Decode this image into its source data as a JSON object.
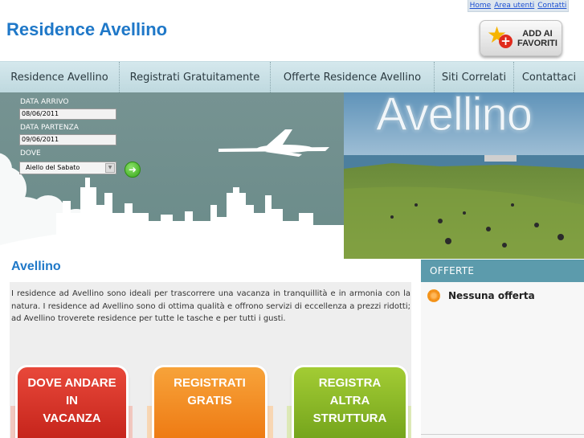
{
  "top_links": [
    "Home",
    "Area utenti",
    "Contatti"
  ],
  "site_title": "Residence Avellino",
  "favorites_button": {
    "line1": "ADD AI",
    "line2": "FAVORITI"
  },
  "nav": [
    "Residence Avellino",
    "Registrati Gratuitamente",
    "Offerte Residence Avellino",
    "Siti Correlati",
    "Contattaci"
  ],
  "search_form": {
    "arrival_label": "DATA ARRIVO",
    "arrival_value": "08/06/2011",
    "departure_label": "DATA PARTENZA",
    "departure_value": "09/06/2011",
    "where_label": "DOVE",
    "where_value": "Aiello del Sabato"
  },
  "banner": {
    "city_name": "Avellino"
  },
  "main": {
    "title": "Avellino",
    "text": "I residence ad Avellino sono ideali per trascorrere una vacanza in tranquillità e in armonia con la natura. I residence ad Avellino sono di ottima qualità e offrono servizi di eccellenza a prezzi ridotti; ad Avellino troverete residence per tutte le tasche e per tutti i gusti."
  },
  "cta": [
    {
      "line1": "DOVE ANDARE",
      "line2": "IN",
      "line3": "VACANZA"
    },
    {
      "line1": "REGISTRATI",
      "line2": "GRATIS",
      "line3": ""
    },
    {
      "line1": "REGISTRA",
      "line2": "ALTRA",
      "line3": "STRUTTURA"
    }
  ],
  "sidebar": {
    "offers_title": "OFFERTE",
    "offers_empty": "Nessuna offerta"
  },
  "colors": {
    "title_blue": "#1f78c8",
    "nav_bg": "#c9e1e6",
    "banner_teal": "#6f8f8d",
    "cta_red": "#d6322a",
    "cta_orange": "#f28a1f",
    "cta_green": "#8bb82a",
    "offers_header": "#5c9bac"
  }
}
